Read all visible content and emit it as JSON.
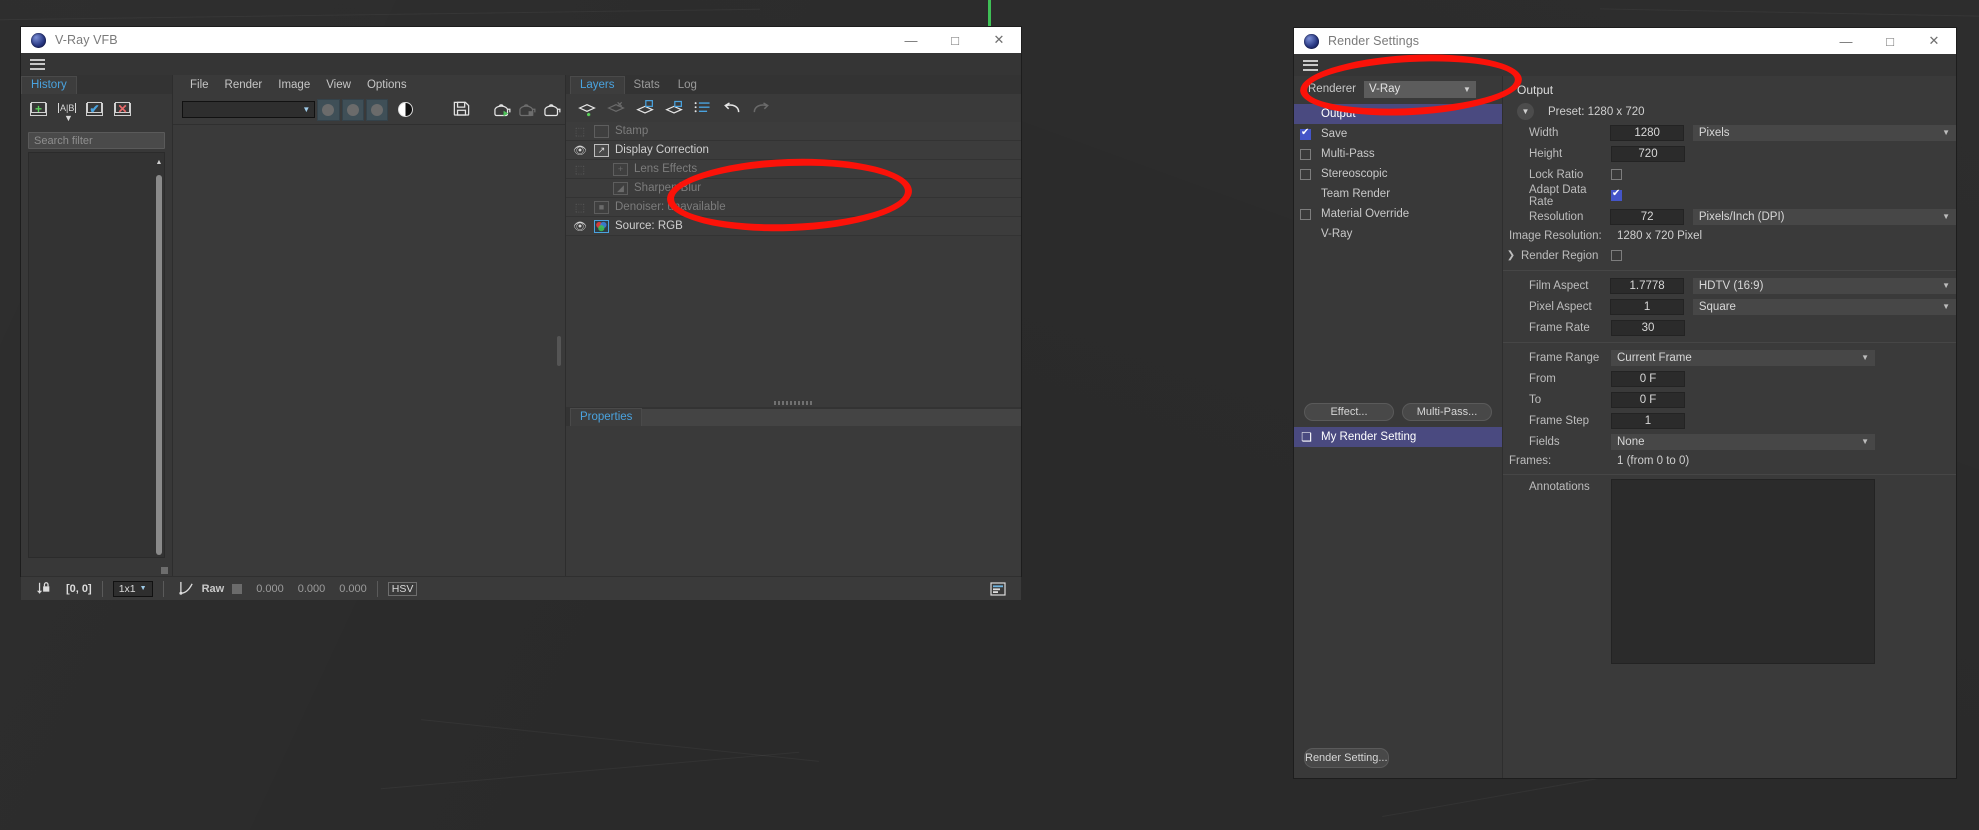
{
  "desktop": {
    "bg": "#2a2a2a"
  },
  "vfb": {
    "title": "V-Ray VFB",
    "window_buttons": {
      "minimize": "—",
      "maximize": "□",
      "close": "✕"
    },
    "history": {
      "tab": "History",
      "tools": [
        {
          "name": "add-history-item",
          "glyph": "+",
          "color": "#5bd15b"
        },
        {
          "name": "compare-ab",
          "glyph": "A|B",
          "color": "#d8d8d8"
        },
        {
          "name": "select-history-item",
          "glyph": "✔",
          "color": "#4aa3df"
        },
        {
          "name": "delete-history-item",
          "glyph": "✕",
          "color": "#e86a6a"
        }
      ],
      "search_placeholder": "Search filter",
      "search_value": ""
    },
    "menu": [
      "File",
      "Render",
      "Image",
      "View",
      "Options"
    ],
    "toolbar": {
      "combo_value": "",
      "buttons": [
        "render-mode-1",
        "render-mode-2",
        "render-mode-3"
      ],
      "icons": [
        "half-circle",
        "save-image",
        "render-teapot-start",
        "render-teapot-stop",
        "render-teapot"
      ]
    },
    "dock": {
      "tabs": [
        "Layers",
        "Stats",
        "Log"
      ],
      "active_tab": "Layers",
      "layer_tools": [
        "add-layer",
        "delete-layer",
        "save-layer",
        "load-layer",
        "layer-list",
        "undo",
        "redo"
      ],
      "layers": [
        {
          "name": "Stamp",
          "visible": false,
          "enabled": false,
          "indent": 0,
          "icon": "stamp-icon"
        },
        {
          "name": "Display Correction",
          "visible": true,
          "enabled": true,
          "indent": 0,
          "icon": "curve-icon"
        },
        {
          "name": "Lens Effects",
          "visible": false,
          "enabled": false,
          "indent": 1,
          "icon": "plus-icon"
        },
        {
          "name": "Sharpen/Blur",
          "visible": false,
          "enabled": false,
          "indent": 1,
          "icon": "sharpen-icon"
        },
        {
          "name": "Denoiser: unavailable",
          "visible": false,
          "enabled": false,
          "indent": 0,
          "icon": "denoise-icon"
        },
        {
          "name": "Source: RGB",
          "visible": true,
          "enabled": true,
          "indent": 0,
          "icon": "rgb-icon"
        }
      ],
      "properties_tab": "Properties"
    },
    "statusbar": {
      "coords": "[0, 0]",
      "zoom": "1x1",
      "mode": "Raw",
      "values": [
        "0.000",
        "0.000",
        "0.000"
      ],
      "color_space": "HSV"
    }
  },
  "render_settings": {
    "title": "Render Settings",
    "window_buttons": {
      "minimize": "—",
      "maximize": "□",
      "close": "✕"
    },
    "renderer_label": "Renderer",
    "renderer_value": "V-Ray",
    "tree": [
      {
        "label": "Output",
        "checkbox": "none",
        "selected": true
      },
      {
        "label": "Save",
        "checkbox": "on",
        "selected": false
      },
      {
        "label": "Multi-Pass",
        "checkbox": "off",
        "selected": false
      },
      {
        "label": "Stereoscopic",
        "checkbox": "off",
        "selected": false
      },
      {
        "label": "Team Render",
        "checkbox": "none",
        "selected": false
      },
      {
        "label": "Material Override",
        "checkbox": "off",
        "selected": false
      },
      {
        "label": "V-Ray",
        "checkbox": "none",
        "selected": false
      }
    ],
    "effect_button": "Effect...",
    "multipass_button": "Multi-Pass...",
    "active_setting": "My Render Setting",
    "render_setting_button": "Render Setting...",
    "output": {
      "section_title": "Output",
      "preset": "Preset: 1280 x 720",
      "width_label": "Width",
      "width_value": "1280",
      "width_unit": "Pixels",
      "height_label": "Height",
      "height_value": "720",
      "lock_ratio_label": "Lock Ratio",
      "lock_ratio": false,
      "adapt_data_rate_label": "Adapt Data Rate",
      "adapt_data_rate": true,
      "resolution_label": "Resolution",
      "resolution_value": "72",
      "resolution_unit": "Pixels/Inch (DPI)",
      "image_resolution_label": "Image Resolution:",
      "image_resolution_value": "1280 x 720 Pixel",
      "render_region_label": "Render Region",
      "render_region": false,
      "film_aspect_label": "Film Aspect",
      "film_aspect_value": "1.7778",
      "film_aspect_preset": "HDTV (16:9)",
      "pixel_aspect_label": "Pixel Aspect",
      "pixel_aspect_value": "1",
      "pixel_aspect_preset": "Square",
      "frame_rate_label": "Frame Rate",
      "frame_rate_value": "30",
      "frame_range_label": "Frame Range",
      "frame_range_value": "Current Frame",
      "from_label": "From",
      "from_value": "0 F",
      "to_label": "To",
      "to_value": "0 F",
      "frame_step_label": "Frame Step",
      "frame_step_value": "1",
      "fields_label": "Fields",
      "fields_value": "None",
      "frames_label": "Frames:",
      "frames_value": "1 (from 0 to 0)",
      "annotations_label": "Annotations",
      "annotations_value": ""
    }
  },
  "annotations": {
    "marker_color": "#fb1209",
    "markers": [
      {
        "name": "marker-layers-ellipse"
      },
      {
        "name": "marker-renderer-ellipse"
      }
    ]
  }
}
